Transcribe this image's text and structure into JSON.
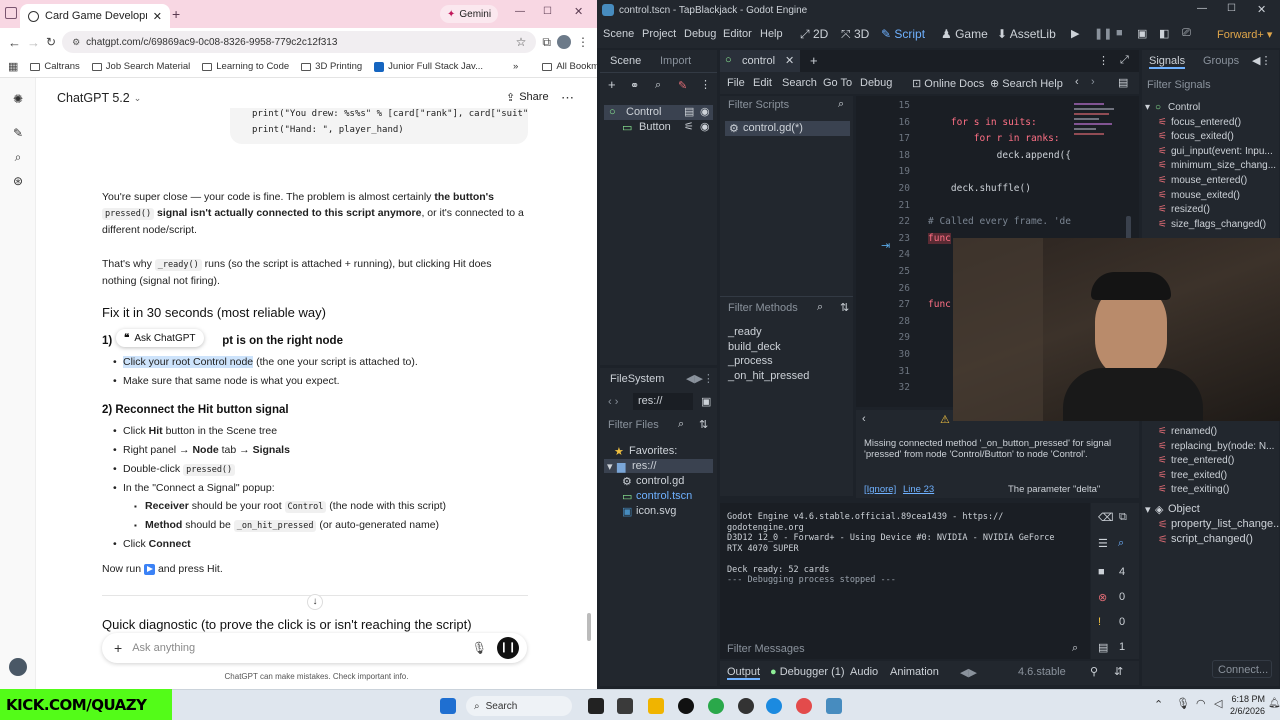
{
  "chrome": {
    "tab_title": "Card Game Development Guide",
    "gemini_label": "Gemini",
    "url": "chatgpt.com/c/69869ac9-0c08-8326-9958-779c2c12f313",
    "bookmarks": [
      "Caltrans",
      "Job Search Material",
      "Learning to Code",
      "3D Printing",
      "Junior Full Stack Jav..."
    ],
    "all_bookmarks": "All Bookmarks"
  },
  "chatgpt": {
    "model": "ChatGPT 5.2",
    "share": "Share",
    "code_line1": "print(\"You drew: %s%s\" % [card[\"rank\"], card[\"suit\"]])",
    "code_line2": "print(\"Hand: \", player_hand)",
    "p1_a": "You're super close — your code is fine. The problem is almost certainly ",
    "p1_b": "the button's",
    "p1_c": "pressed()",
    "p1_d": " signal isn't actually connected to this script anymore",
    "p1_e": ", or it's connected to a",
    "p1_f": "different node/script.",
    "p2_a": "That's why ",
    "p2_b": "_ready()",
    "p2_c": " runs (so the script is attached + running), but clicking Hit does",
    "p2_d": "nothing (signal not firing).",
    "h_fix": "Fix it in 30 seconds (most reliable way)",
    "h1_num": "1)",
    "h1_tail": "pt is on the right node",
    "ask_chatgpt": "Ask ChatGPT",
    "b1_sel": "Click your root Control node",
    "b1_rest": " (the one your script is attached to).",
    "b2": "Make sure that same node is what you expect.",
    "h2": "2) Reconnect the Hit button signal",
    "s1_a": "Click ",
    "s1_b": "Hit",
    "s1_c": " button in the Scene tree",
    "s2_a": "Right panel → ",
    "s2_b": "Node",
    "s2_c": " tab → ",
    "s2_d": "Signals",
    "s3_a": "Double-click ",
    "s3_b": "pressed()",
    "s4": "In the \"Connect a Signal\" popup:",
    "s5_a": "Receiver",
    "s5_b": " should be your root ",
    "s5_c": "Control",
    "s5_d": " (the node with this script)",
    "s6_a": "Method",
    "s6_b": " should be ",
    "s6_c": "_on_hit_pressed",
    "s6_d": " (or auto-generated name)",
    "s7_a": "Click ",
    "s7_b": "Connect",
    "run_a": "Now run",
    "run_b": " and press Hit.",
    "cut": "Quick diagnostic (to prove the click is or isn't reaching the script)",
    "input_placeholder": "Ask anything",
    "disclaimer": "ChatGPT can make mistakes. Check important info."
  },
  "godot": {
    "title": "control.tscn - TapBlackjack - Godot Engine",
    "menu": [
      "Scene",
      "Project",
      "Debug",
      "Editor",
      "Help"
    ],
    "modes": [
      "2D",
      "3D",
      "Script",
      "Game",
      "AssetLib"
    ],
    "renderer": "Forward+",
    "dock_tabs": [
      "Scene",
      "Import"
    ],
    "open_tab": "control",
    "tree": [
      "Control",
      "Button"
    ],
    "script_menu": [
      "File",
      "Edit",
      "Search",
      "Go To",
      "Debug"
    ],
    "online_docs": "Online Docs",
    "search_help": "Search Help",
    "filter_scripts": "Filter Scripts",
    "script_file": "control.gd(*)",
    "filter_methods": "Filter Methods",
    "methods": [
      "_ready",
      "build_deck",
      "_process",
      "_on_hit_pressed"
    ],
    "code": [
      {
        "n": "15",
        "t": ""
      },
      {
        "n": "16",
        "t": "    for s in suits:"
      },
      {
        "n": "17",
        "t": "        for r in ranks:"
      },
      {
        "n": "18",
        "t": "            deck.append({"
      },
      {
        "n": "19",
        "t": ""
      },
      {
        "n": "20",
        "t": "    deck.shuffle()"
      },
      {
        "n": "21",
        "t": ""
      },
      {
        "n": "22",
        "t": "# Called every frame. 'de"
      },
      {
        "n": "23",
        "t": "func"
      },
      {
        "n": "24",
        "t": ""
      },
      {
        "n": "25",
        "t": ""
      },
      {
        "n": "26",
        "t": ""
      },
      {
        "n": "27",
        "t": "func"
      },
      {
        "n": "28",
        "t": ""
      },
      {
        "n": "29",
        "t": ""
      },
      {
        "n": "30",
        "t": ""
      },
      {
        "n": "31",
        "t": ""
      },
      {
        "n": "32",
        "t": ""
      }
    ],
    "warning": "Missing connected method '_on_button_pressed' for signal 'pressed' from node 'Control/Button' to node 'Control'.",
    "ignore": "[Ignore]",
    "line_ref": "Line 23",
    "param": "The parameter \"delta\"",
    "filesystem": "FileSystem",
    "res_path": "res://",
    "filter_files": "Filter Files",
    "favorites": "Favorites:",
    "files": [
      "res://",
      "control.gd",
      "control.tscn",
      "icon.svg"
    ],
    "output_lines": [
      "Godot Engine v4.6.stable.official.89cea1439 - https://",
      "godotengine.org",
      "D3D12 12_0 - Forward+ - Using Device #0: NVIDIA - NVIDIA GeForce",
      "RTX 4070 SUPER",
      "",
      "Deck ready: 52 cards",
      "--- Debugging process stopped ---"
    ],
    "filter_messages": "Filter Messages",
    "counts": [
      "4",
      "0",
      "0",
      "1"
    ],
    "bottom_tabs": [
      "Output",
      "Debugger (1)",
      "Audio",
      "Animation"
    ],
    "version": "4.6.stable",
    "right_tabs": [
      "Signals",
      "Groups"
    ],
    "filter_signals": "Filter Signals",
    "signals_top": [
      "Control",
      "focus_entered()",
      "focus_exited()",
      "gui_input(event: Inpu...",
      "minimum_size_chang...",
      "mouse_entered()",
      "mouse_exited()",
      "resized()",
      "size_flags_changed()"
    ],
    "signals_bottom": [
      "renamed()",
      "replacing_by(node: N...",
      "tree_entered()",
      "tree_exited()",
      "tree_exiting()"
    ],
    "object_section": "Object",
    "object_signals": [
      "property_list_change...",
      "script_changed()"
    ],
    "connect_btn": "Connect..."
  },
  "overlay": {
    "kick": "KICK.COM/QUAZY"
  },
  "taskbar": {
    "search": "Search",
    "time": "6:18 PM",
    "date": "2/6/2026"
  }
}
